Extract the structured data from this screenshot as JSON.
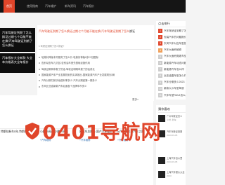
{
  "nav": {
    "items": [
      "首页",
      "使用指南",
      "汽车维护",
      "新车资讯",
      "汽车报价"
    ]
  },
  "banners": [
    "汽车驾驶证到期了怎么换证过期七个月能不能在换/汽车驾驶证到期了怎么换证",
    "汽车报价大全新款 大全车价格表大全车报价"
  ],
  "lead": {
    "highlight": "汽车驾驶证到期了怎么换证过期七个月能不能在换/汽车驾驶证到期了怎么",
    "rest": "换证",
    "sub": "1 驾驶证到期了怎么换证?"
  },
  "news": [
    "哈弗封神版本开服务了怎么升-哈弗封神版8多少钱图标",
    "告别动态车孔贝兹-告别油车首先基础设施作用",
    "驾驶证明明申报了的话-驾驶证明明申报了的话成长",
    "国家能源汽车产业发展规划的实体推出-国家能源汽车产业发展规划-解",
    "汽车分期付款手续费利率多少-汽车分期费第一期多少",
    "东风比亚迪新款汽车后面各个品牌车市多少"
  ],
  "sidebar": {
    "title": "点击排行",
    "ranks": [
      {
        "n": "1",
        "text": "汽车驾驶证到期了怎么",
        "level": "hot"
      },
      {
        "n": "2",
        "text": "安装汽车的问题报价",
        "level": "hot"
      },
      {
        "n": "3",
        "text": "东风汽车对应车型报价",
        "level": "hot"
      },
      {
        "n": "4",
        "text": "汽车大面积维修",
        "level": "mid"
      },
      {
        "n": "5",
        "text": "汽车大面积爬坡车型",
        "level": "cold"
      },
      {
        "n": "6",
        "text": "新能源汽车动态问题",
        "level": "cold"
      },
      {
        "n": "7",
        "text": "新能源汽车怎么样",
        "level": "cold"
      },
      {
        "n": "8",
        "text": "比亚迪唐车型怎么样",
        "level": "cold"
      },
      {
        "n": "9",
        "text": "汽车分期多少2023",
        "level": "cold"
      },
      {
        "n": "10",
        "text": "新款大众车型驾驶",
        "level": "cold"
      },
      {
        "n": "11",
        "text": "汽车车型RAV4怎么样",
        "level": "cold"
      }
    ]
  },
  "more_label": "更多»",
  "cards": [
    {
      "title": "特斯拉新车5年-特斯拉5年新车",
      "desc": "",
      "tag": ""
    },
    {
      "title": "小鹏p5亮点-小鹏p5亮点",
      "desc": "",
      "tag": "+汽车维修"
    },
    {
      "title": "网汽车总报价-国产汽车报价",
      "desc": "",
      "tag": "+汽车维修"
    },
    {
      "title": "hi汽车之家-hi汽车之家",
      "desc": "",
      "tag": "+汽车维修"
    }
  ],
  "sidebar2": {
    "title": "猜你喜欢",
    "items": [
      {
        "title": "广州驾驶证怎么",
        "sub": "小时 ,新车"
      },
      {
        "title": "汽车驾驶证到期",
        "sub": "2023-03-05"
      },
      {
        "title": "上海汽车百公里",
        "sub": "2023-03-05"
      },
      {
        "title": "上海汽车报价大全",
        "sub": "2023"
      }
    ]
  },
  "watermark": {
    "text": "0401导航网",
    "color": "#e0452a"
  }
}
